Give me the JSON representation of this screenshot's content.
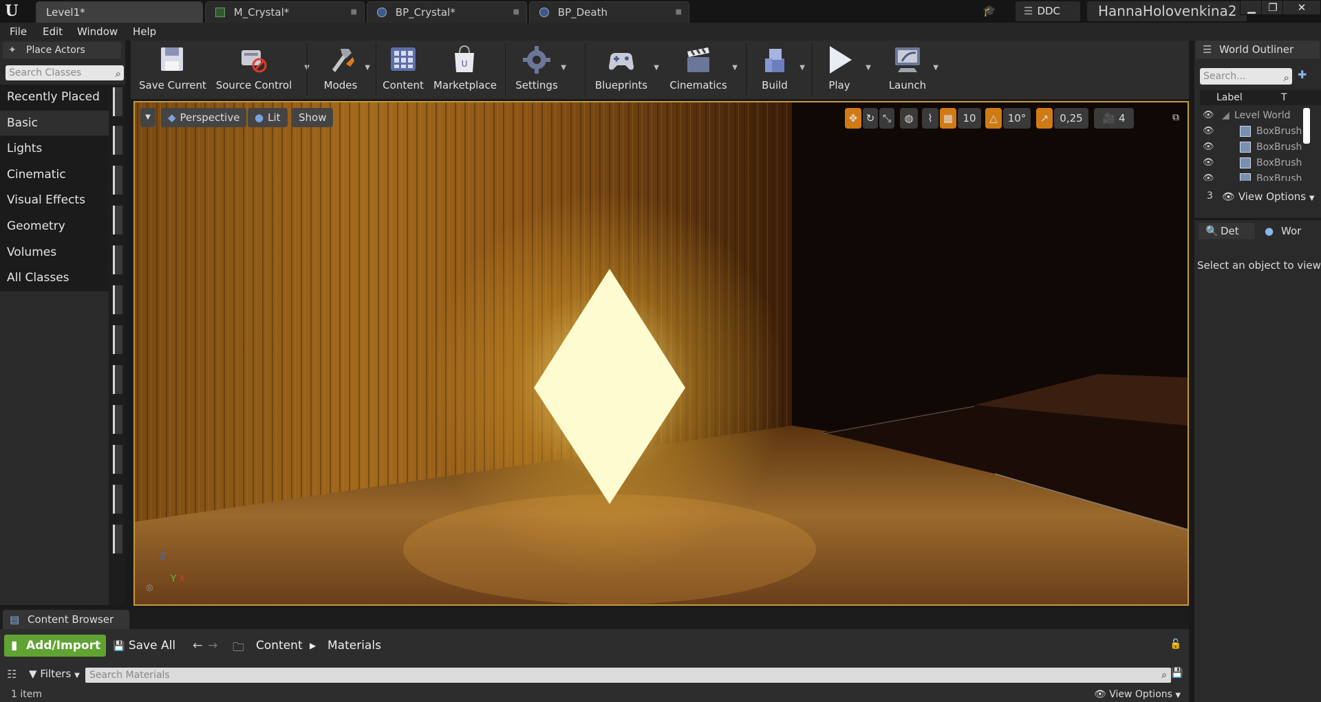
{
  "titlebar": {
    "tabs": [
      {
        "label": "Level1*",
        "icon": "level-icon"
      },
      {
        "label": "M_Crystal*",
        "icon": "material-icon"
      },
      {
        "label": "BP_Crystal*",
        "icon": "blueprint-icon"
      },
      {
        "label": "BP_Death",
        "icon": "blueprint-icon"
      }
    ],
    "ddc": "DDC",
    "username": "HannaHolovenkina2"
  },
  "menu": [
    "File",
    "Edit",
    "Window",
    "Help"
  ],
  "place_actors": {
    "title": "Place Actors",
    "search_placeholder": "Search Classes",
    "categories": [
      "Recently Placed",
      "Basic",
      "Lights",
      "Cinematic",
      "Visual Effects",
      "Geometry",
      "Volumes",
      "All Classes"
    ],
    "active_category": "Basic"
  },
  "toolbar": {
    "save_current": "Save Current",
    "source_control": "Source Control",
    "modes": "Modes",
    "content": "Content",
    "marketplace": "Marketplace",
    "settings": "Settings",
    "blueprints": "Blueprints",
    "cinematics": "Cinematics",
    "build": "Build",
    "play": "Play",
    "launch": "Launch"
  },
  "viewport": {
    "perspective": "Perspective",
    "lit": "Lit",
    "show": "Show",
    "grid_snap": "10",
    "rotation_snap": "10°",
    "scale_snap": "0,25",
    "camera_speed": "4",
    "axis_z": "Z",
    "axis_y": "Y",
    "axis_x": "X"
  },
  "outliner": {
    "title": "World Outliner",
    "search_placeholder": "Search...",
    "col_label": "Label",
    "col_type": "T",
    "rows": [
      "Level World",
      "BoxBrush",
      "BoxBrush",
      "BoxBrush",
      "BoxBrush"
    ],
    "count": "3",
    "view_options": "View Options"
  },
  "details": {
    "tab_details": "Det",
    "tab_world": "Wor",
    "empty_message": "Select an object to view d"
  },
  "content_browser": {
    "title": "Content Browser",
    "add_import": "Add/Import",
    "save_all": "Save All",
    "path": [
      "Content",
      "Materials"
    ],
    "filters": "Filters",
    "search_placeholder": "Search Materials",
    "item_count": "1 item",
    "view_options": "View Options"
  }
}
